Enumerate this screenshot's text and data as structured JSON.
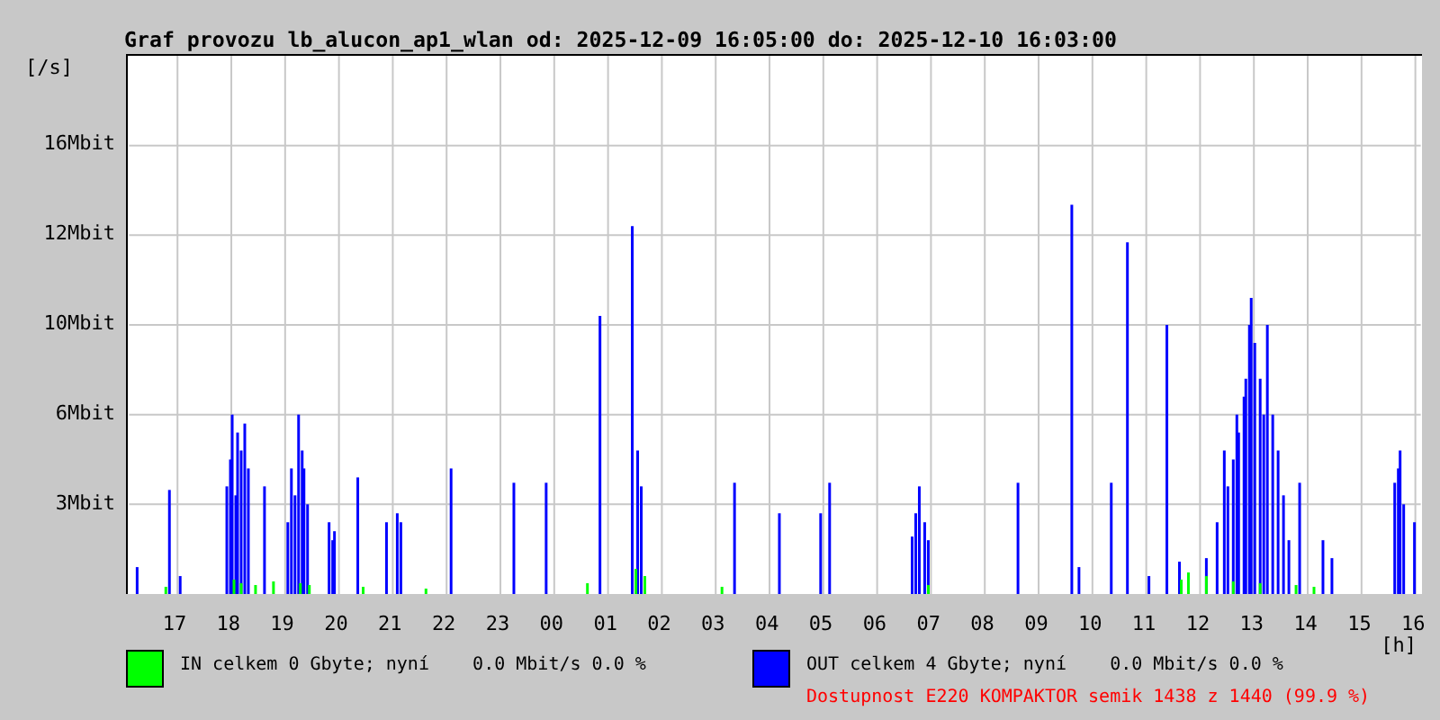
{
  "title": "Graf provozu lb_alucon_ap1_wlan od: 2025-12-09 16:05:00 do: 2025-12-10 16:03:00",
  "y_unit": "[/s]",
  "y_labels": [
    "16Mbit",
    "12Mbit",
    "10Mbit",
    "6Mbit",
    "3Mbit"
  ],
  "x_labels": [
    "17",
    "18",
    "19",
    "20",
    "21",
    "22",
    "23",
    "00",
    "01",
    "02",
    "03",
    "04",
    "05",
    "06",
    "07",
    "08",
    "09",
    "10",
    "11",
    "12",
    "13",
    "14",
    "15",
    "16"
  ],
  "x_unit": "[h]",
  "legend": [
    {
      "color": "#00ff00",
      "text": "IN celkem 0 Gbyte; nyní    0.0 Mbit/s 0.0 %"
    },
    {
      "color": "#0000ff",
      "text": "OUT celkem 4 Gbyte; nyní    0.0 Mbit/s 0.0 %"
    }
  ],
  "availability": "Dostupnost E220 KOMPAKTOR semik 1438 z 1440 (99.9 %)"
}
